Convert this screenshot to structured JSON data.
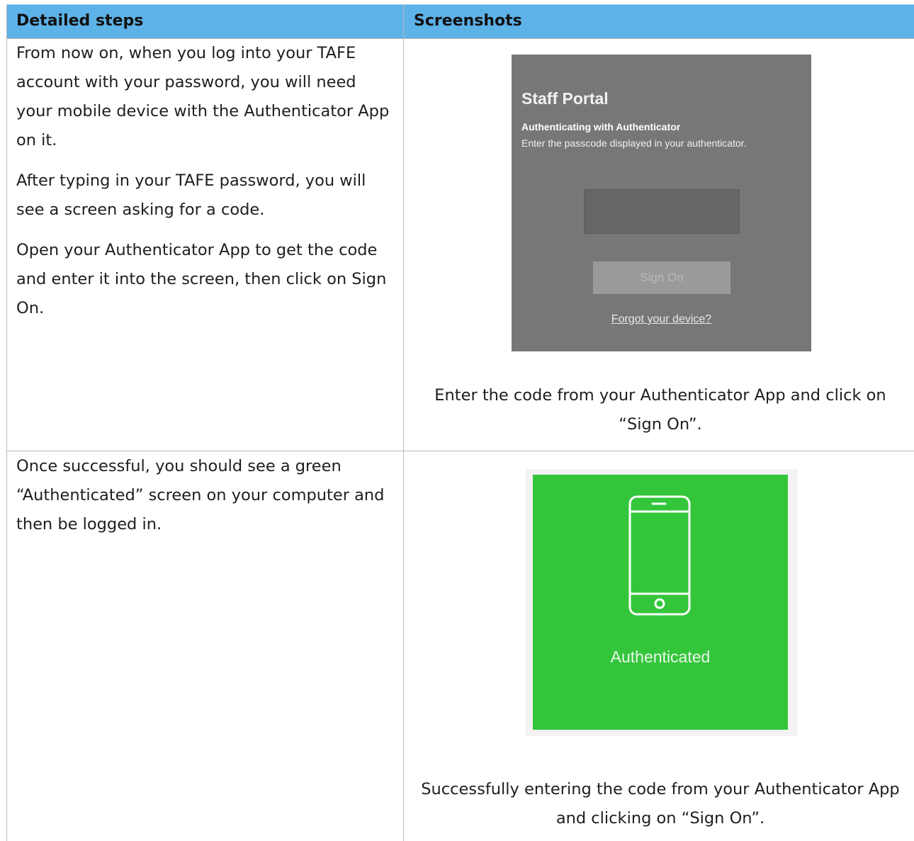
{
  "table": {
    "headers": [
      "Detailed steps",
      "Screenshots"
    ]
  },
  "steps": [
    {
      "paragraphs": [
        "From now on, when you log into your TAFE account with your password, you will need your mobile device with the Authenticator App on it.",
        "After typing in your TAFE password, you will see a screen asking for a code.",
        "Open your Authenticator App to get the code and enter it into the screen, then click on Sign On."
      ],
      "caption": "Enter the code from your Authenticator App and click on “Sign On”."
    },
    {
      "paragraphs": [
        "Once successful, you should see a green “Authenticated” screen on your computer and then be logged in."
      ],
      "caption": "Successfully entering the code from your Authenticator App and clicking on “Sign On”."
    }
  ],
  "portal": {
    "title": "Staff Portal",
    "subtitle": "Authenticating with Authenticator",
    "instructions": "Enter the passcode displayed in your authenticator.",
    "passcode_value": "",
    "signon_label": "Sign On",
    "forgot_link": "Forgot your device?",
    "background_color": "#777777"
  },
  "auth_screen": {
    "label": "Authenticated",
    "icon": "mobile-phone-icon",
    "background_color": "#33c63b"
  },
  "colors": {
    "header_background": "#5db2e8"
  }
}
